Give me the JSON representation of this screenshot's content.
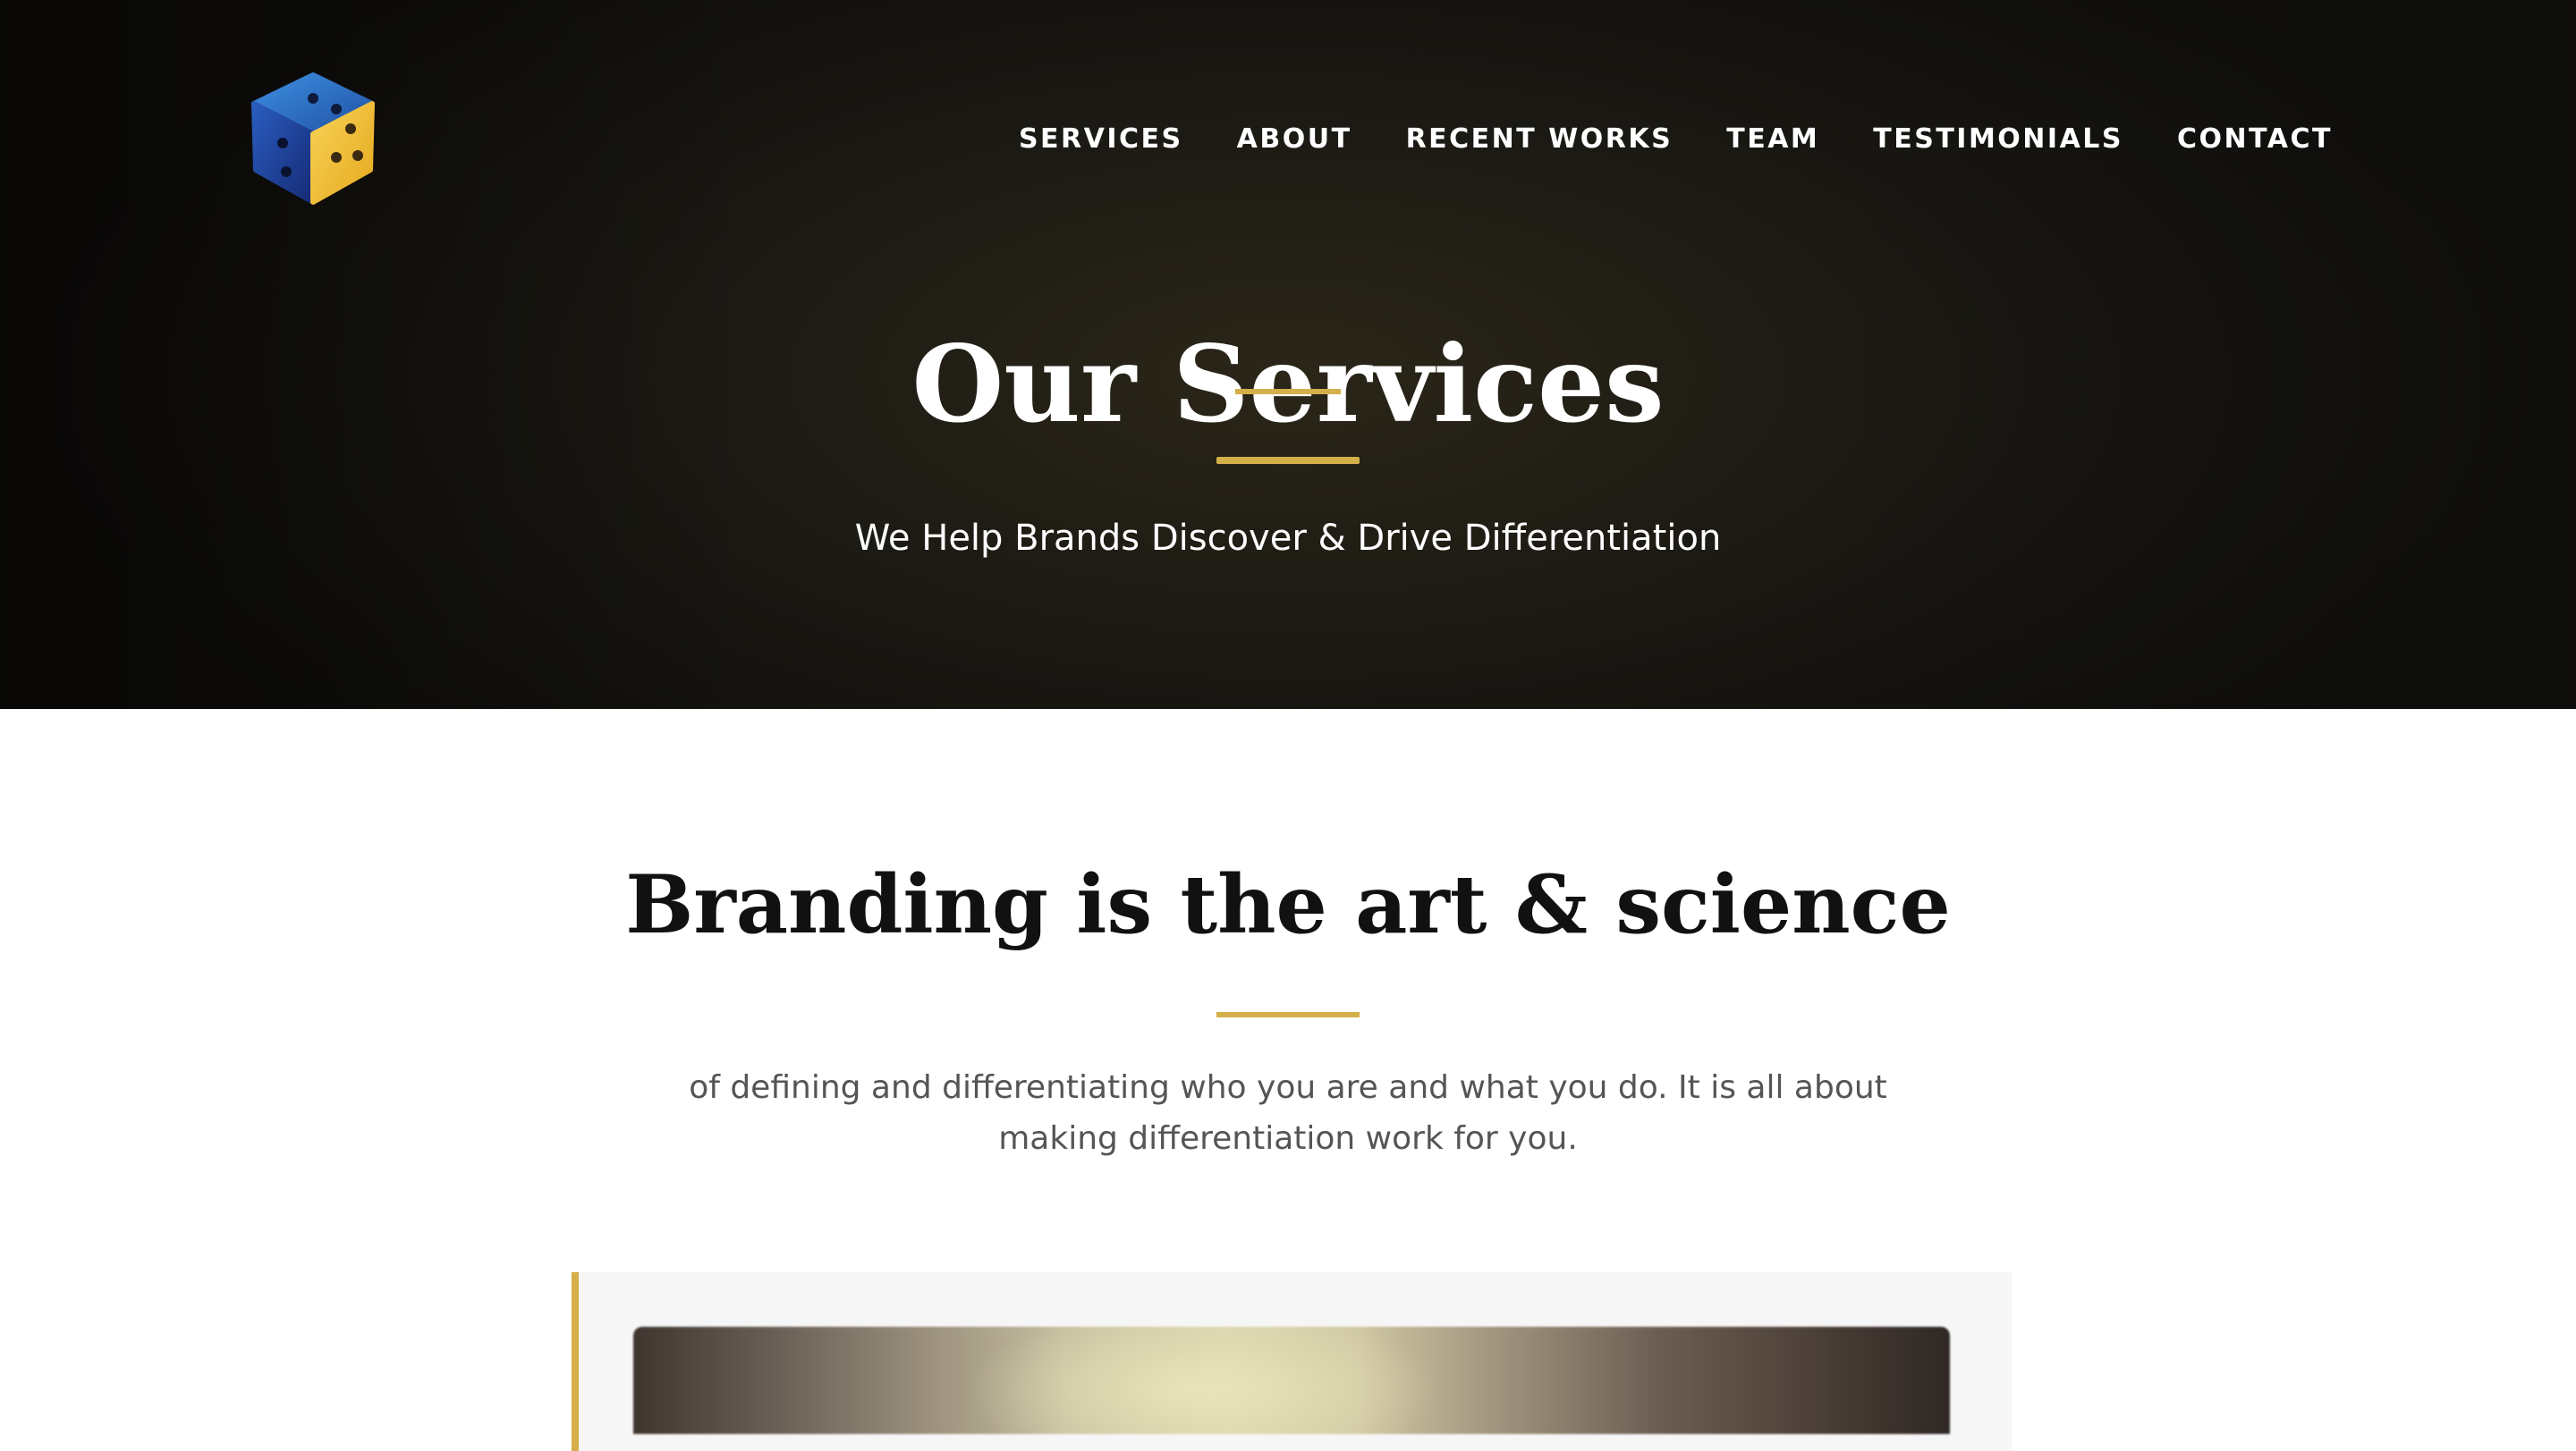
{
  "nav": {
    "items": [
      {
        "label": "SERVICES"
      },
      {
        "label": "ABOUT"
      },
      {
        "label": "RECENT WORKS"
      },
      {
        "label": "TEAM"
      },
      {
        "label": "TESTIMONIALS"
      },
      {
        "label": "CONTACT"
      }
    ]
  },
  "hero": {
    "title": "Our Services",
    "subtitle": "We Help Brands Discover & Drive Differentiation"
  },
  "intro": {
    "title": "Branding is the art & science",
    "text": "of defining and differentiating who you are and what you do. It is all about making differentiation work for you."
  },
  "colors": {
    "accent": "#d4af4a",
    "hero_bg": "#14130f",
    "logo_blue": "#2f6fc2",
    "logo_yellow": "#f2c23c"
  },
  "icons": {
    "logo": "cube-logo-icon"
  }
}
